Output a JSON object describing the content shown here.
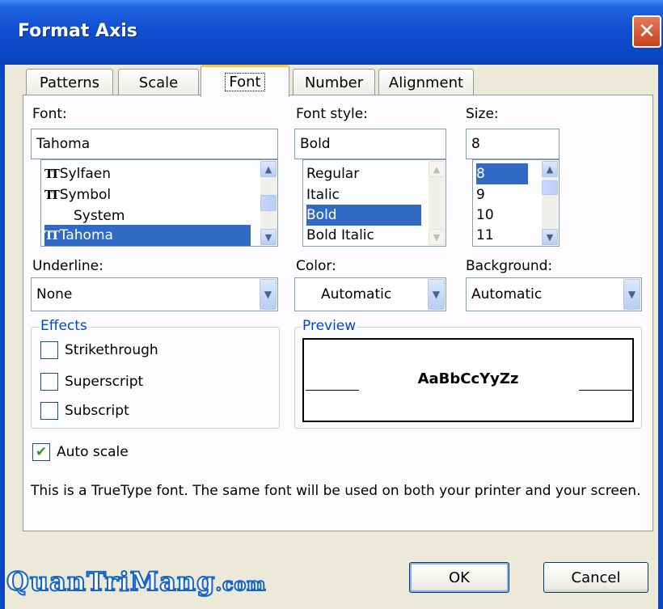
{
  "window": {
    "title": "Format Axis"
  },
  "tabs": [
    {
      "label": "Patterns"
    },
    {
      "label": "Scale"
    },
    {
      "label": "Font"
    },
    {
      "label": "Number"
    },
    {
      "label": "Alignment"
    }
  ],
  "font": {
    "label": "Font:",
    "value": "Tahoma",
    "items": [
      "Sylfaen",
      "Symbol",
      "System",
      "Tahoma"
    ],
    "selected": "Tahoma"
  },
  "font_style": {
    "label": "Font style:",
    "value": "Bold",
    "items": [
      "Regular",
      "Italic",
      "Bold",
      "Bold Italic"
    ],
    "selected": "Bold"
  },
  "size": {
    "label": "Size:",
    "value": "8",
    "items": [
      "8",
      "9",
      "10",
      "11"
    ],
    "selected": "8"
  },
  "underline": {
    "label": "Underline:",
    "value": "None"
  },
  "color": {
    "label": "Color:",
    "value": "Automatic"
  },
  "background": {
    "label": "Background:",
    "value": "Automatic"
  },
  "effects": {
    "legend": "Effects",
    "strikethrough": {
      "label": "Strikethrough",
      "checked": false
    },
    "superscript": {
      "label": "Superscript",
      "checked": false
    },
    "subscript": {
      "label": "Subscript",
      "checked": false
    }
  },
  "preview": {
    "legend": "Preview",
    "sample": "AaBbCcYyZz"
  },
  "auto_scale": {
    "label": "Auto scale",
    "checked": true
  },
  "info_text": "This is a TrueType font.  The same font will be used on both your printer and your screen.",
  "buttons": {
    "ok": "OK",
    "cancel": "Cancel"
  },
  "watermark": {
    "main": "QuanTriMang",
    "suffix": ".com"
  },
  "colors": {
    "selection": "#316ac5",
    "titlebar": "#0b46c4",
    "close": "#c6421f",
    "group_legend": "#0046d5",
    "dialog_bg": "#ece9d8"
  }
}
